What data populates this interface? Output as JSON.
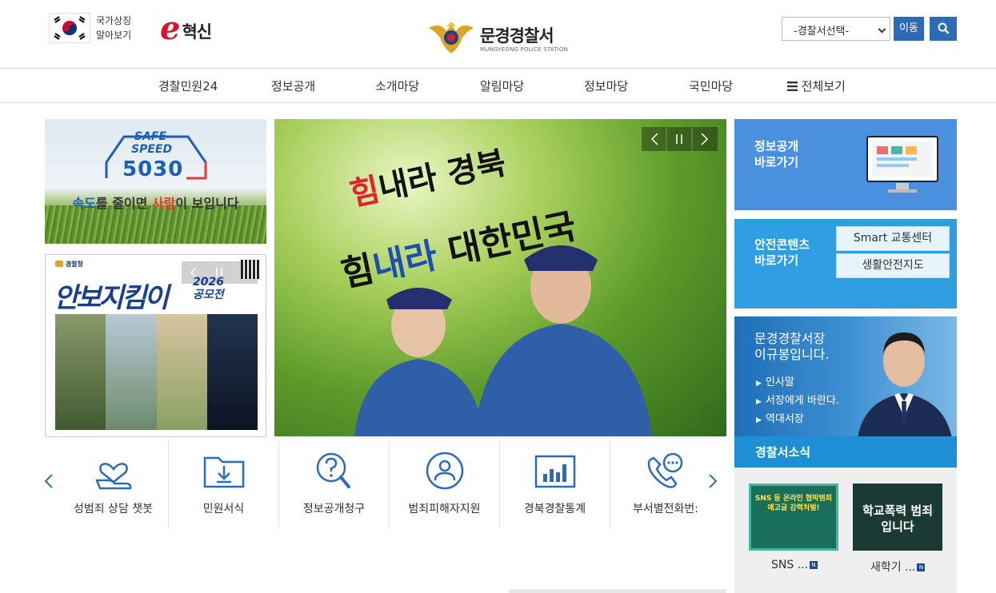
{
  "header": {
    "symbol_label_1": "국가상징",
    "symbol_label_2": "알아보기",
    "einno_e": "e",
    "einno_text": "혁신",
    "site_title": "문경경찰서",
    "site_subtitle": "MUNGYEONG POLICE STATION",
    "station_select": "-경찰서선택-",
    "go_label": "이동"
  },
  "nav": {
    "items": [
      "경찰민원24",
      "정보공개",
      "소개마당",
      "알림마당",
      "정보마당",
      "국민마당"
    ],
    "all_menu": "전체보기"
  },
  "banners": {
    "safe_msg_1": "속도",
    "safe_msg_2": "를 줄이면 ",
    "safe_msg_3": "사람",
    "safe_msg_4": "이 보입니다",
    "safe_logo_1": "SAFE",
    "safe_logo_2": "SPEED",
    "safe_logo_3": "5030",
    "anbo_org": "경찰청",
    "anbo_title": "안보지킴이",
    "anbo_year": "2026",
    "anbo_sub": "공모전"
  },
  "main_visual": {
    "line1_a": "힘",
    "line1_b": "내라 경북",
    "line2_a": "힘",
    "line2_b": "내라",
    "line2_c": " 대한민국"
  },
  "quick_icons": [
    {
      "label": "성범죄 상담 챗봇",
      "icon": "heart-hand-icon"
    },
    {
      "label": "민원서식",
      "icon": "folder-download-icon"
    },
    {
      "label": "정보공개청구",
      "icon": "question-search-icon"
    },
    {
      "label": "범죄피해자지원",
      "icon": "person-circle-icon"
    },
    {
      "label": "경북경찰통계",
      "icon": "bar-chart-icon"
    },
    {
      "label": "부서별전화번:",
      "icon": "phone-chat-icon"
    }
  ],
  "right": {
    "info_title_1": "정보공개",
    "info_title_2": "바로가기",
    "safety_title_1": "안전콘텐츠",
    "safety_title_2": "바로가기",
    "safety_btn_1": "Smart 교통센터",
    "safety_btn_2": "생활안전지도",
    "chief_line_1": "문경경찰서장",
    "chief_line_2": "이규봉입니다.",
    "chief_links": [
      "인사말",
      "서장에게 바란다.",
      "역대서장"
    ],
    "news_title": "경찰서소식",
    "news": [
      {
        "caption": "SNS ...",
        "thumb_text": "SNS 등 온라인 협박범죄 예고글 강력처벌!"
      },
      {
        "caption": "새학기 ...",
        "thumb_text": "학교폭력 범죄입니다"
      }
    ],
    "news_badge": "N"
  },
  "colors": {
    "primary": "#2e6bb7",
    "info_bg": "#4b8fdf",
    "safety_bg": "#2f9ee0",
    "news_head": "#1e8fd5"
  }
}
